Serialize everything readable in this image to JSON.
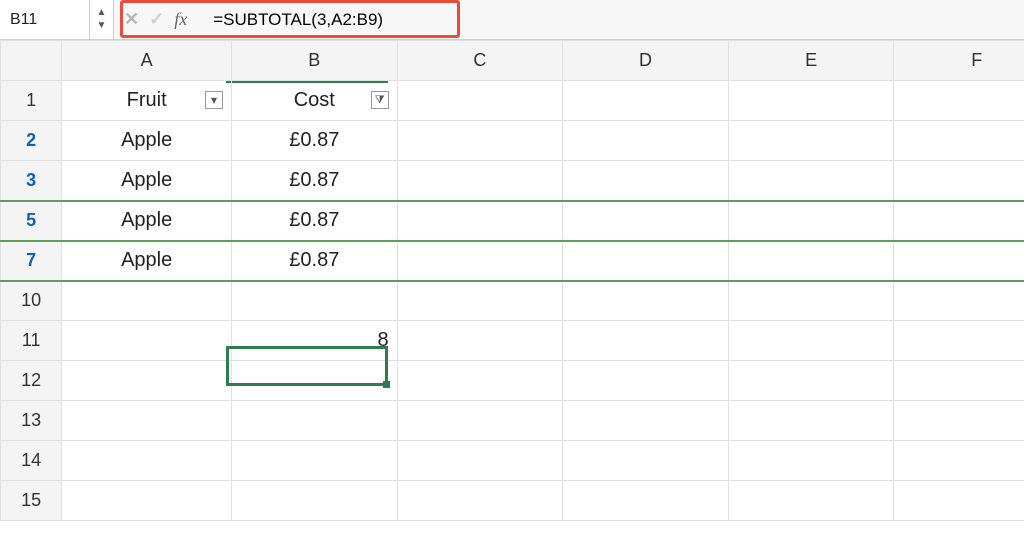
{
  "formula_bar": {
    "active_cell": "B11",
    "cancel_glyph": "✕",
    "accept_glyph": "✓",
    "fx_label": "fx",
    "formula": "=SUBTOTAL(3,A2:B9)"
  },
  "columns": [
    "A",
    "B",
    "C",
    "D",
    "E",
    "F"
  ],
  "visible_rows": [
    {
      "num": "1",
      "filtered": false
    },
    {
      "num": "2",
      "filtered": true
    },
    {
      "num": "3",
      "filtered": true
    },
    {
      "num": "5",
      "filtered": true
    },
    {
      "num": "7",
      "filtered": true
    },
    {
      "num": "10",
      "filtered": false
    },
    {
      "num": "11",
      "filtered": false
    },
    {
      "num": "12",
      "filtered": false
    },
    {
      "num": "13",
      "filtered": false
    },
    {
      "num": "14",
      "filtered": false
    },
    {
      "num": "15",
      "filtered": false
    }
  ],
  "headers": {
    "A": "Fruit",
    "B": "Cost"
  },
  "data": {
    "r2": {
      "A": "Apple",
      "B": "£0.87"
    },
    "r3": {
      "A": "Apple",
      "B": "£0.87"
    },
    "r5": {
      "A": "Apple",
      "B": "£0.87"
    },
    "r7": {
      "A": "Apple",
      "B": "£0.87"
    }
  },
  "result": {
    "B11": "8"
  },
  "filter_glyphs": {
    "dropdown": "▾",
    "active_filter": "⧩"
  },
  "colors": {
    "highlight_red": "#e74c3c",
    "selection_green": "#2f7d4f",
    "filtered_row_blue": "#0a62b9"
  }
}
